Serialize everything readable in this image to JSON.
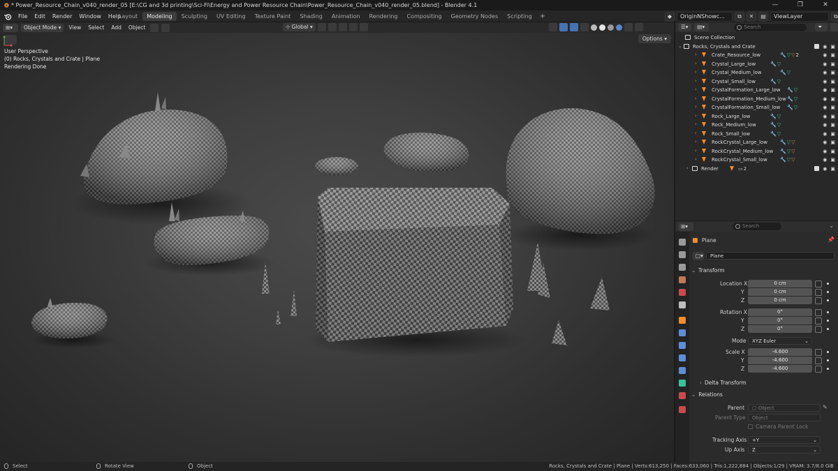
{
  "window": {
    "title": "* Power_Resource_Chain_v040_render_05 [E:\\CG and 3d printing\\Sci-Fi\\Energy and Power Resource Chain\\Power_Resource_Chain_v040_render_05.blend] - Blender 4.1",
    "controls": [
      "—",
      "❐",
      "✕"
    ]
  },
  "menubar": {
    "menus": [
      "File",
      "Edit",
      "Render",
      "Window",
      "Help"
    ],
    "workspaces": [
      "Layout",
      "Modeling",
      "Sculpting",
      "UV Editing",
      "Texture Paint",
      "Shading",
      "Animation",
      "Rendering",
      "Compositing",
      "Geometry Nodes",
      "Scripting"
    ],
    "active_workspace": "Modeling",
    "add_tab": "+",
    "scene": "OriginNShowc...",
    "view_layer": "ViewLayer"
  },
  "viewport_header": {
    "mode": "Object Mode",
    "menus": [
      "View",
      "Select",
      "Add",
      "Object"
    ],
    "orientation": "Global",
    "options": "Options"
  },
  "viewport": {
    "perspective": "User Perspective",
    "context": "(0) Rocks, Crystals and Crate | Plane",
    "status": "Rendering Done"
  },
  "statusbar": {
    "select": "Select",
    "rotate": "Rotate View",
    "object": "Object",
    "stats": "Rocks, Crystals and Crate | Plane | Verts:613,250 | Faces:633,060 | Tris:1,222,884 | Objects:1/29 | VRAM: 3.7/8.0 GiB"
  },
  "outliner": {
    "search_placeholder": "Search",
    "scene_collection": "Scene Collection",
    "collection": "Rocks, Crystals and Crate",
    "objects": [
      {
        "name": "Crate_Resource_low",
        "mods": "wrench mesh mat",
        "count": "2"
      },
      {
        "name": "Crystal_Large_low",
        "mods": "wrench mesh",
        "count": ""
      },
      {
        "name": "Crystal_Medium_low",
        "mods": "wrench mesh",
        "count": ""
      },
      {
        "name": "Crystal_Small_low",
        "mods": "wrench mesh",
        "count": ""
      },
      {
        "name": "CrystalFormation_Large_low",
        "mods": "wrench mesh",
        "count": ""
      },
      {
        "name": "CrystalFormation_Medium_low",
        "mods": "wrench mesh",
        "count": ""
      },
      {
        "name": "CrystalFormation_Small_low",
        "mods": "wrench mesh",
        "count": ""
      },
      {
        "name": "Rock_Large_low",
        "mods": "wrench mesh",
        "count": ""
      },
      {
        "name": "Rock_Medium_low",
        "mods": "wrench mesh",
        "count": ""
      },
      {
        "name": "Rock_Small_low",
        "mods": "wrench mesh",
        "count": ""
      },
      {
        "name": "RockCrystal_Large_low",
        "mods": "wrench mesh mat",
        "count": ""
      },
      {
        "name": "RockCrystal_Medium_low",
        "mods": "wrench mesh mat",
        "count": ""
      },
      {
        "name": "RockCrystal_Small_low",
        "mods": "wrench mesh mat",
        "count": ""
      }
    ],
    "render_collection": "Render",
    "render_count": "2"
  },
  "properties": {
    "search_placeholder": "Search",
    "object_name": "Plane",
    "data_name": "Plane",
    "transform": {
      "title": "Transform",
      "location_label": "Location X",
      "location": [
        "0 cm",
        "0 cm",
        "0 cm"
      ],
      "rotation_label": "Rotation X",
      "rotation": [
        "0°",
        "0°",
        "0°"
      ],
      "mode_label": "Mode",
      "mode": "XYZ Euler",
      "scale_label": "Scale X",
      "scale": [
        "-4.600",
        "-4.600",
        "-4.600"
      ],
      "axis_y": "Y",
      "axis_z": "Z"
    },
    "delta_transform": "Delta Transform",
    "relations": {
      "title": "Relations",
      "parent_label": "Parent",
      "parent_placeholder": "Object",
      "parent_type_label": "Parent Type",
      "parent_type": "Object",
      "camera_parent_lock": "Camera Parent Lock",
      "tracking_axis_label": "Tracking Axis",
      "tracking_axis": "+Y",
      "up_axis_label": "Up Axis",
      "up_axis": "Z"
    }
  },
  "colors": {
    "accent": "#4772b3",
    "object_orange": "#f08d2d",
    "mesh_green": "#39c29a",
    "modifier_blue": "#7f9ce0"
  }
}
